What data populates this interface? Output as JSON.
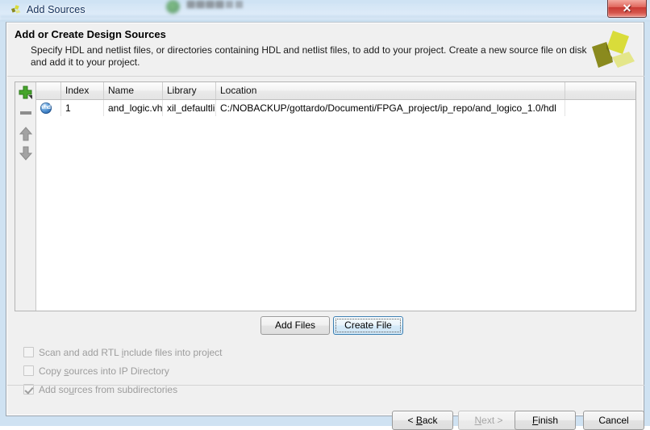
{
  "window": {
    "title": "Add Sources",
    "icon": "vivado-logo-icon",
    "close_label": "✕"
  },
  "header": {
    "title": "Add or Create Design Sources",
    "description": "Specify HDL and netlist files, or directories containing HDL and netlist files, to add to your project. Create a new source file on disk and add it to your project.",
    "logo": "vivado-logo-icon"
  },
  "toolbar": {
    "add_label": "+",
    "remove_label": "−",
    "move_up_label": "↑",
    "move_down_label": "↓"
  },
  "table": {
    "columns": [
      "",
      "Index",
      "Name",
      "Library",
      "Location"
    ],
    "rows": [
      {
        "icon": "vhdl-file-icon",
        "icon_text": "vhd",
        "index": "1",
        "name": "and_logic.vhd",
        "library": "xil_defaultlib",
        "location": "C:/NOBACKUP/gottardo/Documenti/FPGA_project/ip_repo/and_logico_1.0/hdl"
      }
    ]
  },
  "actions": {
    "add_files": "Add Files",
    "create_file": "Create File"
  },
  "options": [
    {
      "label_pre": "Scan and add RTL ",
      "mnemonic": "i",
      "label_post": "nclude files into project",
      "checked": false,
      "enabled": false
    },
    {
      "label_pre": "Copy ",
      "mnemonic": "s",
      "label_post": "ources into IP Directory",
      "checked": false,
      "enabled": false
    },
    {
      "label_pre": "Add so",
      "mnemonic": "u",
      "label_post": "rces from subdirectories",
      "checked": true,
      "enabled": false
    }
  ],
  "navigation": {
    "back_pre": "< ",
    "back_mnemonic": "B",
    "back_post": "ack",
    "next_pre": "",
    "next_mnemonic": "N",
    "next_post": "ext >",
    "finish_pre": "",
    "finish_mnemonic": "F",
    "finish_post": "inish",
    "cancel": "Cancel"
  },
  "colors": {
    "accent_green": "#4aa32e",
    "logo_olive": "#8a8a1e",
    "logo_yellow": "#d9dc3a",
    "focus_blue": "#3c7fb1",
    "close_red": "#c93a33"
  }
}
